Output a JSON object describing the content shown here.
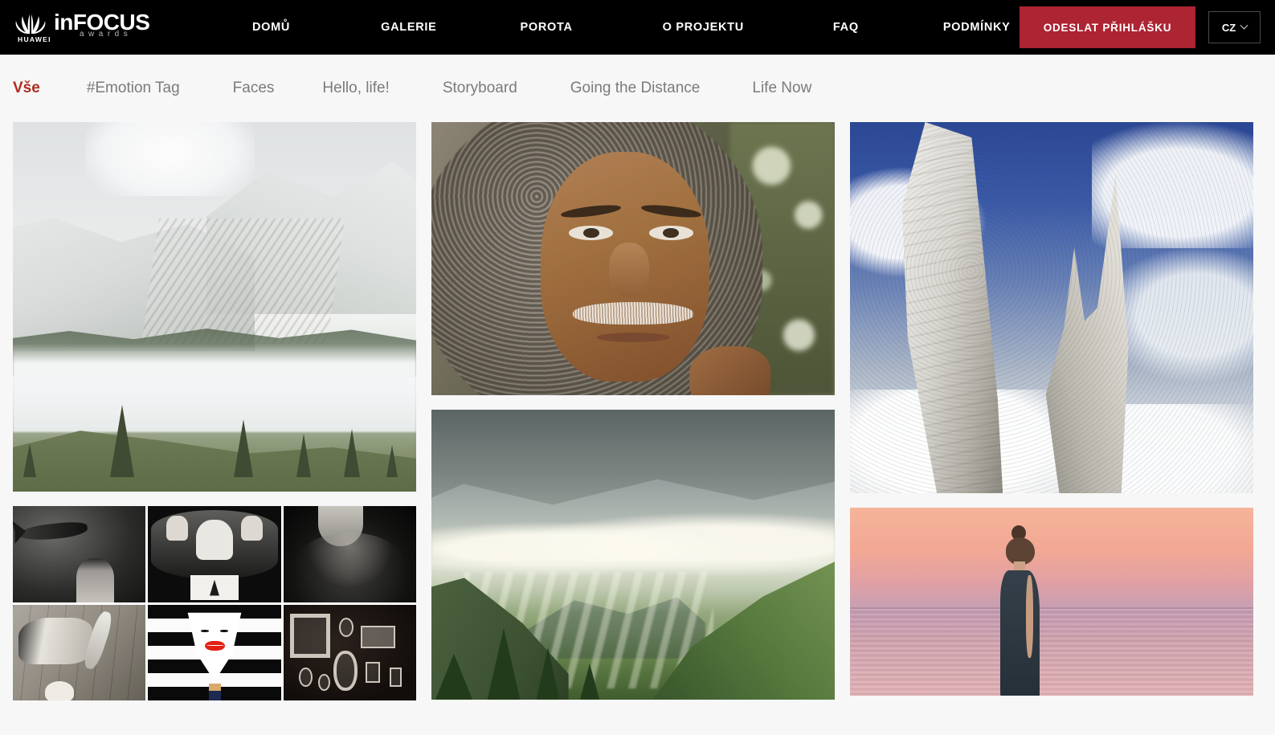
{
  "brand": {
    "huawei_wordmark": "HUAWEI",
    "logo_in": "in",
    "logo_focus": "FOCUS",
    "logo_awards": "awards"
  },
  "topnav": {
    "links": [
      {
        "label": "DOMŮ",
        "name": "nav-home"
      },
      {
        "label": "GALERIE",
        "name": "nav-gallery"
      },
      {
        "label": "POROTA",
        "name": "nav-jury"
      },
      {
        "label": "O PROJEKTU",
        "name": "nav-about"
      },
      {
        "label": "FAQ",
        "name": "nav-faq"
      },
      {
        "label": "PODMÍNKY",
        "name": "nav-terms"
      }
    ],
    "submit_label": "ODESLAT PŘIHLÁŠKU",
    "language": "CZ",
    "accent_color": "#ad2433",
    "background_color": "#000000"
  },
  "filters": {
    "active_index": 0,
    "active_color": "#b02b1f",
    "inactive_color": "#7b7b7b",
    "items": [
      {
        "label": "Vše",
        "name": "filter-all"
      },
      {
        "label": "#Emotion Tag",
        "name": "filter-emotion-tag"
      },
      {
        "label": "Faces",
        "name": "filter-faces"
      },
      {
        "label": "Hello, life!",
        "name": "filter-hello-life"
      },
      {
        "label": "Storyboard",
        "name": "filter-storyboard"
      },
      {
        "label": "Going the Distance",
        "name": "filter-going-the-distance"
      },
      {
        "label": "Life Now",
        "name": "filter-life-now"
      }
    ]
  },
  "gallery": {
    "background_color": "#f7f7f7",
    "columns": [
      {
        "name": "gallery-column-1",
        "items": [
          {
            "name": "photo-mountain-fog",
            "alt": "Zasněžené dolomitské štíty nad mořem mlhy se smrky v popředí"
          },
          {
            "name": "photo-bw-collage",
            "alt": "Černobílá koláž šesti snímků s červenými rty uprostřed"
          }
        ]
      },
      {
        "name": "gallery-column-2",
        "items": [
          {
            "name": "photo-elder-portrait",
            "alt": "Portrét staršího muže s hustými šedivými kudrnami a bílým knírem"
          },
          {
            "name": "photo-valley-sunrays",
            "alt": "Zelené horské údolí s paprsky slunce prostupujícími mraky"
          }
        ]
      },
      {
        "name": "gallery-column-3",
        "items": [
          {
            "name": "photo-stone-sculpture",
            "alt": "Bílá kamenná socha proti modré obloze s bílými mraky"
          },
          {
            "name": "photo-woman-sunset-sea",
            "alt": "Žena v tmavých šatech stojící v moři při růžovém západu slunce"
          }
        ]
      }
    ]
  }
}
